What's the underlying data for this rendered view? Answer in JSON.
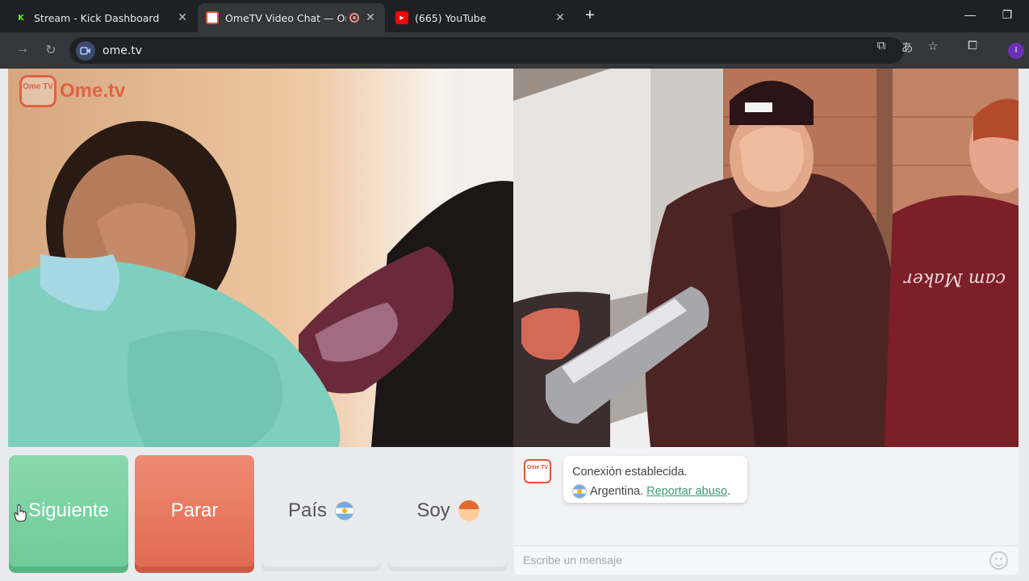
{
  "browser": {
    "tabs": [
      {
        "title": "Stream - Kick Dashboard",
        "favicon": "kick-icon",
        "active": false
      },
      {
        "title": "OmeTV Video Chat — Ome",
        "favicon": "ometv-icon",
        "active": true,
        "recording": true
      },
      {
        "title": "(665) YouTube",
        "favicon": "youtube-icon",
        "active": false
      }
    ],
    "url": "ome.tv",
    "profile_initial": "I"
  },
  "logo": {
    "badge": "Ome TV",
    "text": "Ome.tv"
  },
  "controls": {
    "next_label": "Siguiente",
    "stop_label": "Parar",
    "country_label": "País",
    "gender_label": "Soy"
  },
  "chat": {
    "logo_badge": "Ome TV",
    "status": "Conexión establecida.",
    "country": "Argentina.",
    "report_link": "Reportar abuso",
    "report_suffix": ".",
    "placeholder": "Escribe un mensaje"
  },
  "colors": {
    "next": "#6fcb98",
    "stop": "#e26b52",
    "brand": "#e0563a",
    "link": "#3a9a76"
  }
}
